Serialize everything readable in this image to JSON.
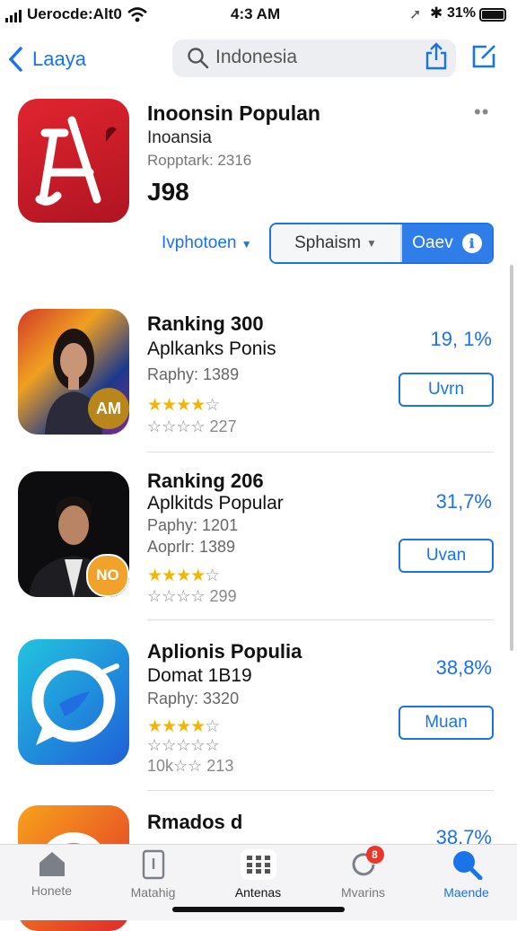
{
  "status_bar": {
    "carrier": "Uerocde:Alt0",
    "time": "4:3 AM",
    "battery": "31%"
  },
  "nav": {
    "back_label": "Laaya",
    "search_text": "Indonesia"
  },
  "featured": {
    "title": "Inoonsin Populan",
    "subtitle": "Inoansia",
    "reviews": "Ropptark: 2316",
    "number": "J98",
    "filter_label": "Ivphotoen",
    "segment_left": "Sphaism",
    "segment_right": "Oaev"
  },
  "apps": [
    {
      "title1": "Ranking 300",
      "title2": "Aplkanks Ponis",
      "line3": "Raphy: 1389",
      "stars": "★★★★☆",
      "rating": "☆☆☆☆ 227",
      "percent": "19, 1%",
      "button": "Uvrn",
      "badge": "AM"
    },
    {
      "title1": "Ranking 206",
      "title2": "Aplkitds Popular",
      "line3": "Paphy: 1201",
      "line4": "Aoprlr: 1389",
      "stars": "★★★★☆",
      "rating": "☆☆☆☆ 299",
      "percent": "31,7%",
      "button": "Uvan",
      "badge": "NO"
    },
    {
      "title1": "Aplionis Populia",
      "title2": "Domat 1B19",
      "line3": "Raphy: 3320",
      "stars": "★★★★☆",
      "rating2": "☆☆☆☆☆",
      "rating": "10k☆☆ 213",
      "percent": "38,8%",
      "button": "Muan"
    },
    {
      "title1": "Rmados d",
      "percent": "38.7%"
    }
  ],
  "tabs": [
    {
      "label": "Honete"
    },
    {
      "label": "Matahig"
    },
    {
      "label": "Antenas"
    },
    {
      "label": "Mvarins",
      "badge": "8"
    },
    {
      "label": "Maende"
    }
  ],
  "colors": {
    "accent": "#1a73e8",
    "featured_icon": "#d41f2b",
    "star": "#f4b400"
  }
}
